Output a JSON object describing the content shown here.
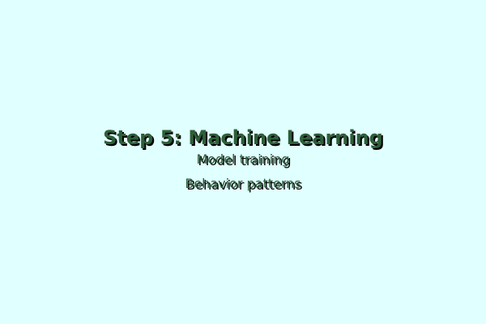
{
  "colors": {
    "background": "#e0ffff",
    "text": "#2e5e3a",
    "shadow": "#000000"
  },
  "title": "Step 5: Machine Learning",
  "lines": [
    "Model training",
    "Behavior patterns"
  ]
}
